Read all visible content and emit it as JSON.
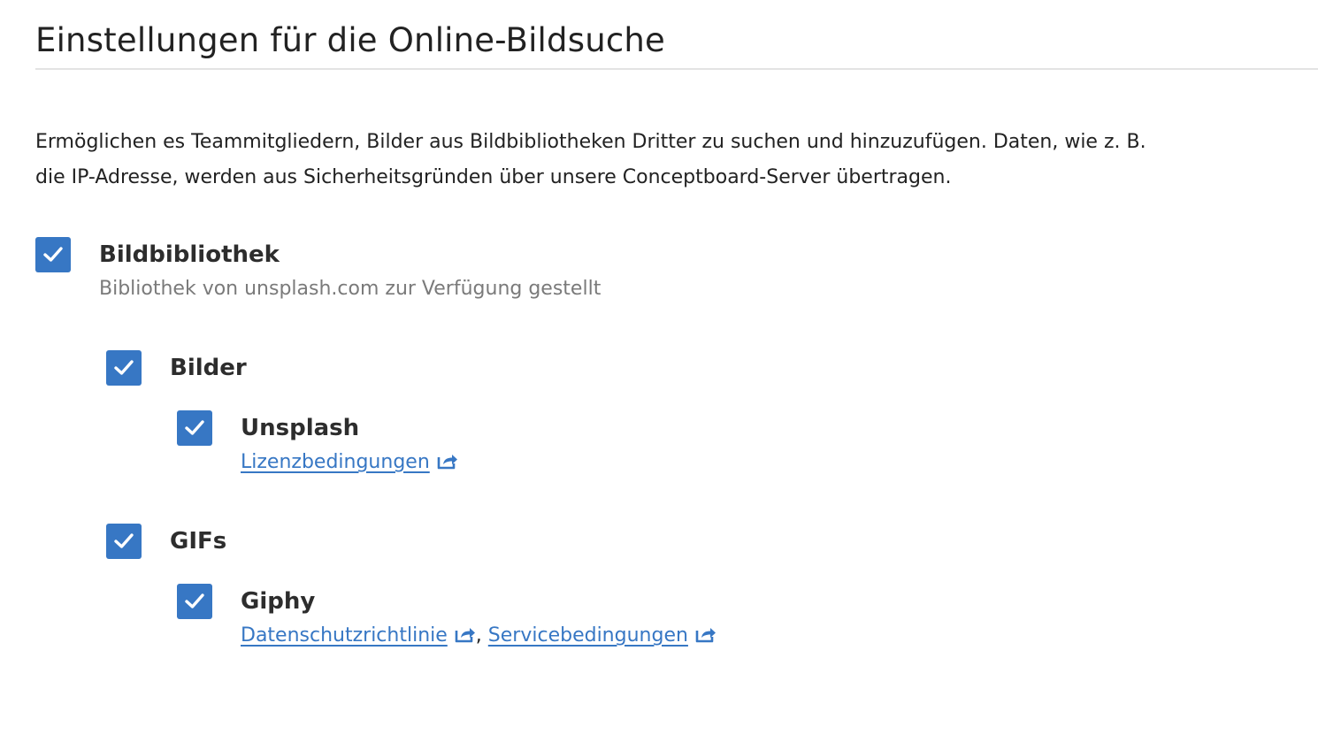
{
  "page": {
    "title": "Einstellungen für die Online-Bildsuche",
    "description": "Ermöglichen es Teammitgliedern, Bilder aus Bildbibliotheken Dritter zu suchen und hinzuzufügen. Daten, wie z. B. die IP-Adresse, werden aus Sicherheitsgründen über unsere Conceptboard-Server übertragen."
  },
  "options": {
    "library": {
      "label": "Bildbibliothek",
      "subtitle": "Bibliothek von unsplash.com zur Verfügung gestellt",
      "checked": true
    },
    "images": {
      "label": "Bilder",
      "checked": true
    },
    "unsplash": {
      "label": "Unsplash",
      "checked": true,
      "link_license": "Lizenzbedingungen"
    },
    "gifs": {
      "label": "GIFs",
      "checked": true
    },
    "giphy": {
      "label": "Giphy",
      "checked": true,
      "link_privacy": "Datenschutzrichtlinie",
      "separator": ",",
      "link_terms": "Servicebedingungen"
    }
  },
  "colors": {
    "accent": "#3777c4",
    "text": "#222222",
    "muted": "#7a7a7a",
    "rule": "#e3e3e3"
  },
  "icons": {
    "checkbox_check": "check-icon",
    "external_link": "external-link-icon"
  }
}
